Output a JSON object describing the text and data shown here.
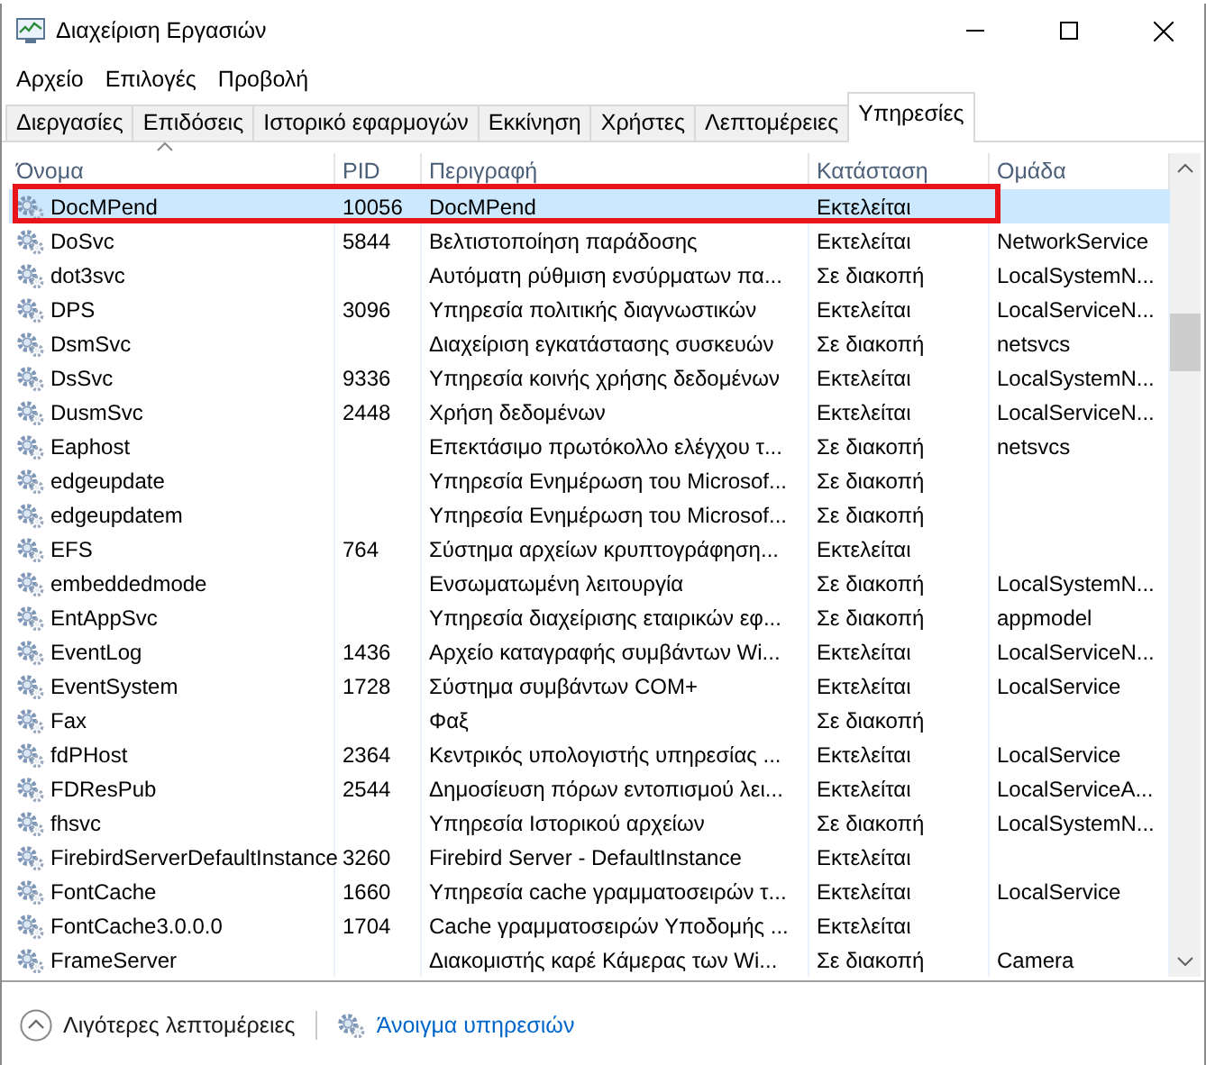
{
  "window": {
    "title": "Διαχείριση Εργασιών"
  },
  "menu": [
    "Αρχείο",
    "Επιλογές",
    "Προβολή"
  ],
  "tabs": [
    {
      "label": "Διεργασίες",
      "selected": false
    },
    {
      "label": "Επιδόσεις",
      "selected": false
    },
    {
      "label": "Ιστορικό εφαρμογών",
      "selected": false
    },
    {
      "label": "Εκκίνηση",
      "selected": false
    },
    {
      "label": "Χρήστες",
      "selected": false
    },
    {
      "label": "Λεπτομέρειες",
      "selected": false
    },
    {
      "label": "Υπηρεσίες",
      "selected": true
    }
  ],
  "table": {
    "columns": [
      "Όνομα",
      "PID",
      "Περιγραφή",
      "Κατάσταση",
      "Ομάδα"
    ],
    "rows": [
      {
        "name": "DocMPend",
        "pid": "10056",
        "description": "DocMPend",
        "status": "Εκτελείται",
        "selected": true
      },
      {
        "name": "DoSvc",
        "pid": "5844",
        "description": "Βελτιστοποίηση παράδοσης",
        "status": "Εκτελείται",
        "group": "NetworkService",
        "selected": false
      },
      {
        "name": "dot3svc",
        "description": "Αυτόματη ρύθμιση ενσύρματων πα...",
        "status": "Σε διακοπή",
        "group": "LocalSystemN...",
        "selected": false
      },
      {
        "name": "DPS",
        "pid": "3096",
        "description": "Υπηρεσία πολιτικής διαγνωστικών",
        "status": "Εκτελείται",
        "group": "LocalServiceN...",
        "selected": false
      },
      {
        "name": "DsmSvc",
        "description": "Διαχείριση εγκατάστασης συσκευών",
        "status": "Σε διακοπή",
        "group": "netsvcs",
        "selected": false
      },
      {
        "name": "DsSvc",
        "pid": "9336",
        "description": "Υπηρεσία κοινής χρήσης δεδομένων",
        "status": "Εκτελείται",
        "group": "LocalSystemN...",
        "selected": false
      },
      {
        "name": "DusmSvc",
        "pid": "2448",
        "description": "Χρήση δεδομένων",
        "status": "Εκτελείται",
        "group": "LocalServiceN...",
        "selected": false
      },
      {
        "name": "Eaphost",
        "description": "Επεκτάσιμο πρωτόκολλο ελέγχου τ...",
        "status": "Σε διακοπή",
        "group": "netsvcs",
        "selected": false
      },
      {
        "name": "edgeupdate",
        "description": "Υπηρεσία Ενημέρωση του Microsof...",
        "status": "Σε διακοπή",
        "selected": false
      },
      {
        "name": "edgeupdatem",
        "description": "Υπηρεσία Ενημέρωση του Microsof...",
        "status": "Σε διακοπή",
        "selected": false
      },
      {
        "name": "EFS",
        "pid": "764",
        "description": "Σύστημα αρχείων κρυπτογράφηση...",
        "status": "Εκτελείται",
        "selected": false
      },
      {
        "name": "embeddedmode",
        "description": "Ενσωματωμένη λειτουργία",
        "status": "Σε διακοπή",
        "group": "LocalSystemN...",
        "selected": false
      },
      {
        "name": "EntAppSvc",
        "description": "Υπηρεσία διαχείρισης εταιρικών εφ...",
        "status": "Σε διακοπή",
        "group": "appmodel",
        "selected": false
      },
      {
        "name": "EventLog",
        "pid": "1436",
        "description": "Αρχείο καταγραφής συμβάντων Wi...",
        "status": "Εκτελείται",
        "group": "LocalServiceN...",
        "selected": false
      },
      {
        "name": "EventSystem",
        "pid": "1728",
        "description": "Σύστημα συμβάντων COM+",
        "status": "Εκτελείται",
        "group": "LocalService",
        "selected": false
      },
      {
        "name": "Fax",
        "description": "Φαξ",
        "status": "Σε διακοπή",
        "selected": false
      },
      {
        "name": "fdPHost",
        "pid": "2364",
        "description": "Κεντρικός υπολογιστής υπηρεσίας ...",
        "status": "Εκτελείται",
        "group": "LocalService",
        "selected": false
      },
      {
        "name": "FDResPub",
        "pid": "2544",
        "description": "Δημοσίευση πόρων εντοπισμού λει...",
        "status": "Εκτελείται",
        "group": "LocalServiceA...",
        "selected": false
      },
      {
        "name": "fhsvc",
        "description": "Υπηρεσία Ιστορικού αρχείων",
        "status": "Σε διακοπή",
        "group": "LocalSystemN...",
        "selected": false
      },
      {
        "name": "FirebirdServerDefaultInstance",
        "pid": "3260",
        "description": "Firebird Server - DefaultInstance",
        "status": "Εκτελείται",
        "selected": false
      },
      {
        "name": "FontCache",
        "pid": "1660",
        "description": "Υπηρεσία cache γραμματοσειρών τ...",
        "status": "Εκτελείται",
        "group": "LocalService",
        "selected": false
      },
      {
        "name": "FontCache3.0.0.0",
        "pid": "1704",
        "description": "Cache γραμματοσειρών Υποδομής ...",
        "status": "Εκτελείται",
        "selected": false
      },
      {
        "name": "FrameServer",
        "description": "Διακομιστής καρέ Κάμερας των Wi...",
        "status": "Σε διακοπή",
        "group": "Camera",
        "selected": false
      }
    ]
  },
  "footer": {
    "details_toggle": "Λιγότερες λεπτομέρειες",
    "open_services": "Άνοιγμα υπηρεσιών"
  }
}
